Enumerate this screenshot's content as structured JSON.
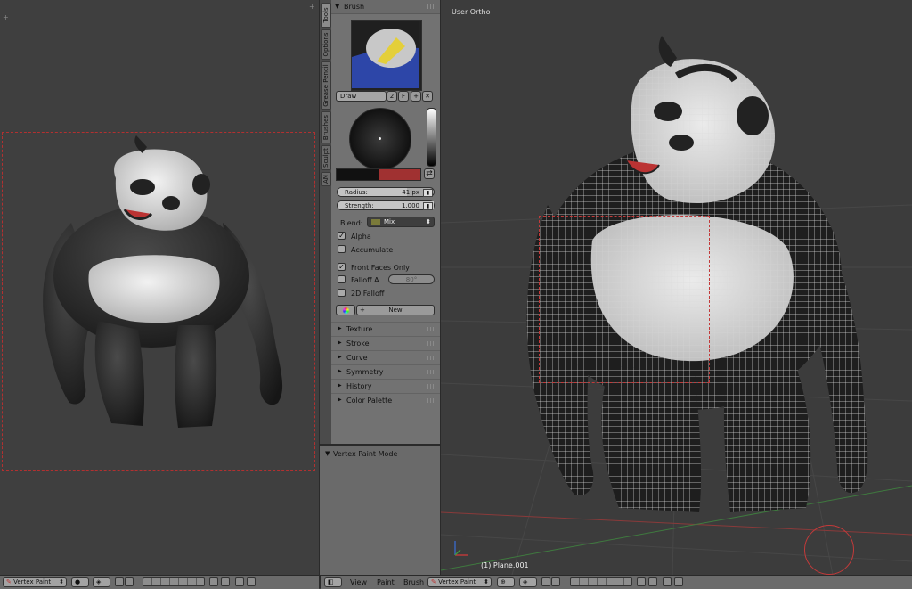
{
  "left_view": {
    "corner_left": "+",
    "corner_right": "+"
  },
  "tabs": [
    "Tools",
    "Options",
    "Grease Pencil",
    "Brushes",
    "Sculpt",
    "AN"
  ],
  "brush_panel": {
    "header": "Brush",
    "brush_name": "Draw",
    "users": "2",
    "fake_user": "F",
    "add": "+",
    "remove": "✕",
    "radius_label": "Radius:",
    "radius_value": "41 px",
    "strength_label": "Strength:",
    "strength_value": "1.000",
    "blend_label": "Blend:",
    "blend_value": "Mix",
    "alpha_label": "Alpha",
    "alpha_checked": true,
    "accumulate_label": "Accumulate",
    "accumulate_checked": false,
    "front_faces_label": "Front Faces Only",
    "front_faces_checked": true,
    "falloff_label": "Falloff A..",
    "falloff_checked": false,
    "falloff_angle": "80°",
    "falloff_2d_label": "2D Falloff",
    "falloff_2d_checked": false,
    "new_label": "New",
    "primary_color": "#111111",
    "secondary_color": "#a03131"
  },
  "subpanels": [
    "Texture",
    "Stroke",
    "Curve",
    "Symmetry",
    "History",
    "Color Palette"
  ],
  "vertex_paint_mode_panel": "Vertex Paint Mode",
  "right_view": {
    "view_label": "User Ortho",
    "object_label": "(1) Plane.001"
  },
  "left_header": {
    "mode": "Vertex Paint"
  },
  "right_header": {
    "menus": [
      "View",
      "Paint",
      "Brush"
    ],
    "mode": "Vertex Paint"
  },
  "colors": {
    "selection": "#c23a3a",
    "x_axis": "#8a3a3a",
    "y_axis": "#3f7a3f"
  }
}
